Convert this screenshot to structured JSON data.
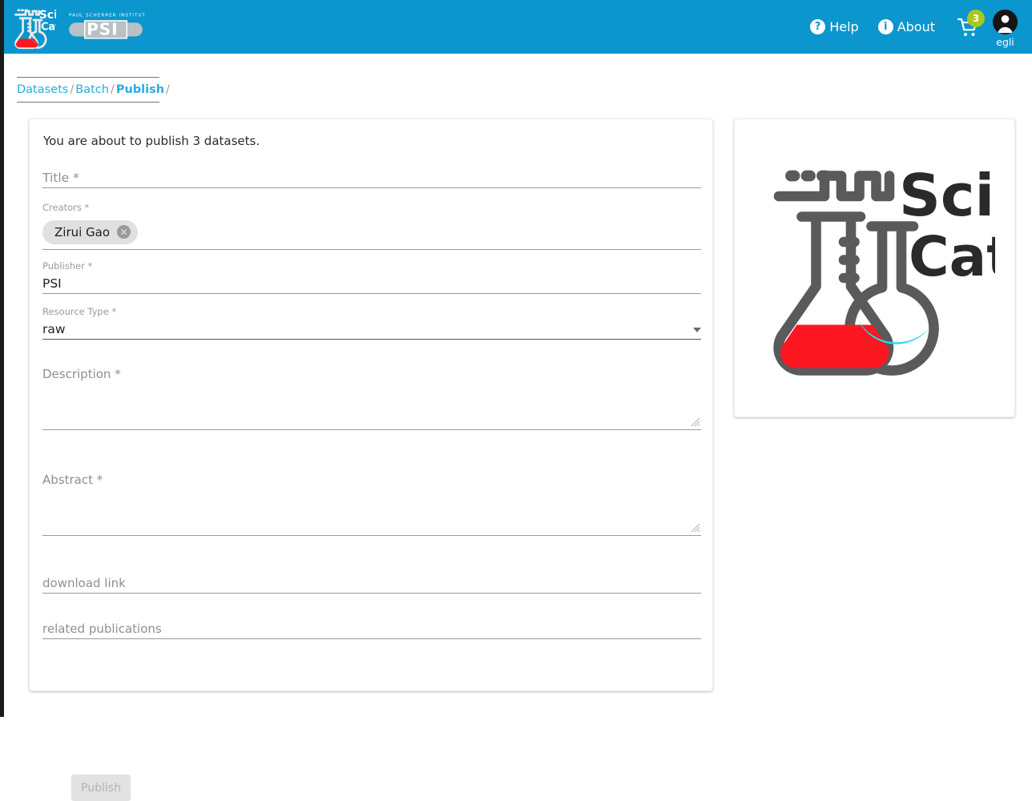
{
  "theme": {
    "header_blue": "#0b96ce",
    "link_blue": "#29abe2",
    "badge_green": "#a9c81b",
    "chip_gray": "#e0e0e0",
    "flask_red": "#fc1721",
    "flask_cyan": "#22dcf0",
    "logo_gray": "#5a5a5a"
  },
  "header": {
    "brand_logo_name": "scicat-logo",
    "institute_logo_name": "psi-logo",
    "institute_logo_top_text": "PAUL SCHERRER INSTITUT",
    "institute_logo_main_text": "PSI",
    "help_label": "Help",
    "help_icon": "question-mark-circle-icon",
    "about_label": "About",
    "about_icon": "info-circle-icon",
    "cart_icon": "shopping-cart-icon",
    "cart_badge_count": "3",
    "avatar_icon": "user-avatar-icon",
    "username": "egli"
  },
  "breadcrumb": {
    "items": [
      {
        "label": "Datasets",
        "current": false
      },
      {
        "label": "Batch",
        "current": false
      },
      {
        "label": "Publish",
        "current": true
      }
    ],
    "separator": "/",
    "trailing_separator": "/"
  },
  "form": {
    "intro_text": "You are about to publish 3 datasets.",
    "title": {
      "label": "Title *",
      "value": "",
      "placeholder": "Title *"
    },
    "creators": {
      "label": "Creators *",
      "chips": [
        {
          "name": "Zirui Gao",
          "remove_icon": "close-circle-icon",
          "remove_glyph": "✕"
        }
      ]
    },
    "publisher": {
      "label": "Publisher *",
      "value": "PSI"
    },
    "resource_type": {
      "label": "Resource Type *",
      "value": "raw",
      "dropdown_icon": "chevron-down-icon"
    },
    "description": {
      "label": "Description *",
      "value": "",
      "resize_handle_icon": "resize-handle-icon"
    },
    "abstract": {
      "label": "Abstract *",
      "value": "",
      "resize_handle_icon": "resize-handle-icon"
    },
    "download_link": {
      "label": "download link",
      "value": "",
      "placeholder": "download link"
    },
    "related_publications": {
      "label": "related publications",
      "value": "",
      "placeholder": "related publications"
    },
    "publish_button": {
      "label": "Publish",
      "disabled": true
    }
  },
  "logo_panel": {
    "logo_name": "scicat-logo-large",
    "text_line_1": "Sci",
    "text_line_2": "Cat"
  }
}
